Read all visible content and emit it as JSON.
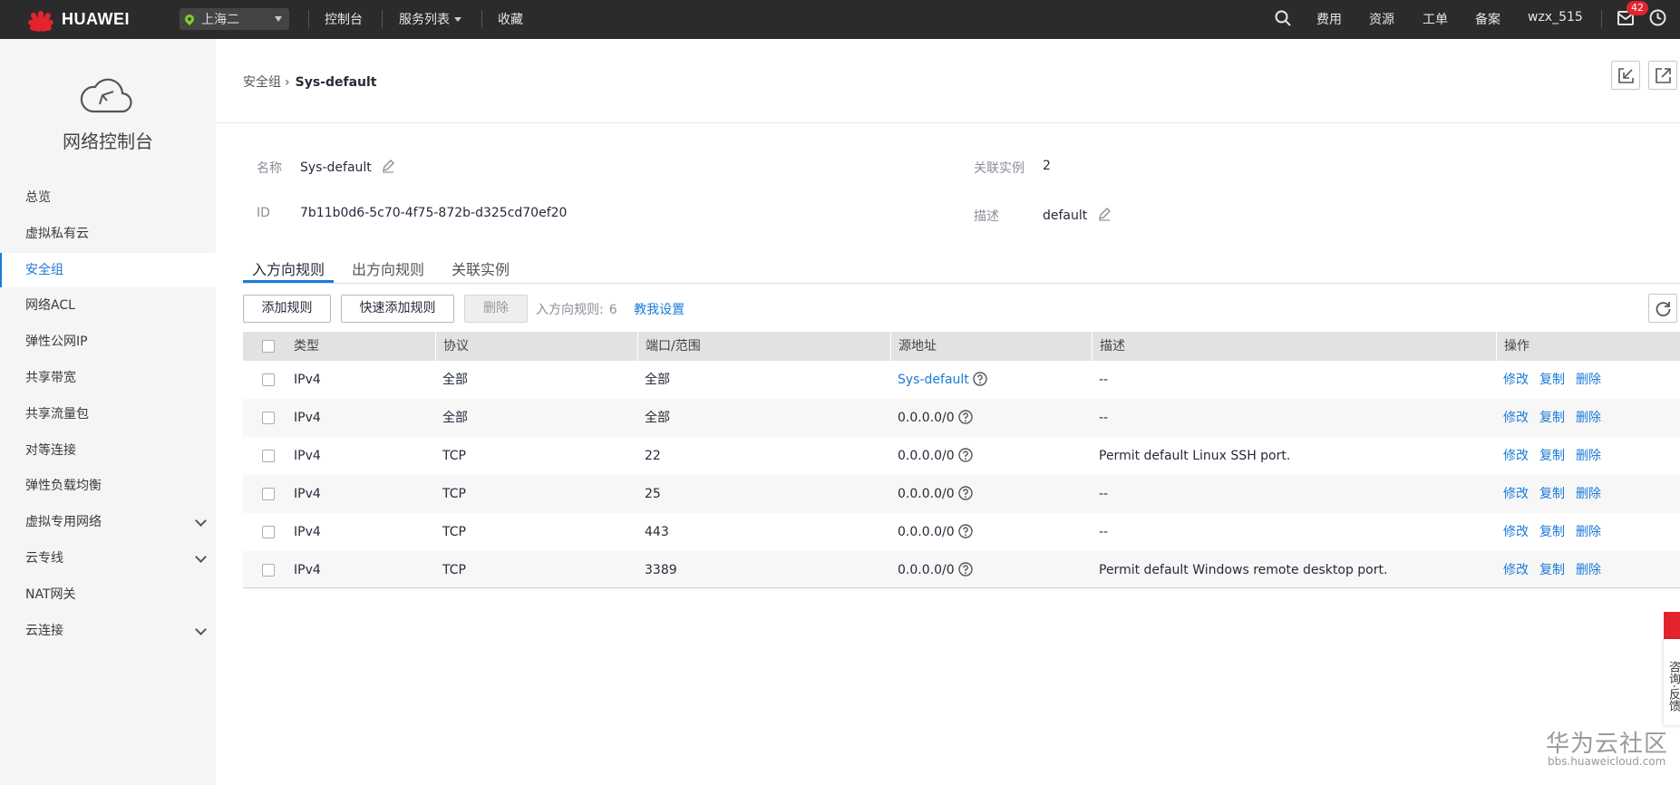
{
  "topbar": {
    "brand": "HUAWEI",
    "region": "上海二",
    "nav": [
      "控制台",
      "服务列表",
      "收藏"
    ],
    "right_links": [
      "费用",
      "资源",
      "工单",
      "备案"
    ],
    "username": "wzx_515",
    "mail_count": "42"
  },
  "sidebar": {
    "title": "网络控制台",
    "items": [
      {
        "label": "总览"
      },
      {
        "label": "虚拟私有云"
      },
      {
        "label": "安全组"
      },
      {
        "label": "网络ACL"
      },
      {
        "label": "弹性公网IP"
      },
      {
        "label": "共享带宽"
      },
      {
        "label": "共享流量包"
      },
      {
        "label": "对等连接"
      },
      {
        "label": "弹性负载均衡"
      },
      {
        "label": "虚拟专用网络"
      },
      {
        "label": "云专线"
      },
      {
        "label": "NAT网关"
      },
      {
        "label": "云连接"
      }
    ],
    "active": "安全组"
  },
  "breadcrumb": {
    "parent": "安全组",
    "sep": "›",
    "current": "Sys-default"
  },
  "info": {
    "name_label": "名称",
    "name_value": "Sys-default",
    "id_label": "ID",
    "id_value": "7b11b0d6-5c70-4f75-872b-d325cd70ef20",
    "instances_label": "关联实例",
    "instances_value": "2",
    "desc_label": "描述",
    "desc_value": "default"
  },
  "tabs": [
    "入方向规则",
    "出方向规则",
    "关联实例"
  ],
  "toolbar": {
    "add_rule": "添加规则",
    "quick_add": "快速添加规则",
    "delete": "删除",
    "count_label": "入方向规则:",
    "count_value": "6",
    "help_link": "教我设置"
  },
  "table": {
    "headers": [
      "类型",
      "协议",
      "端口/范围",
      "源地址",
      "描述",
      "操作"
    ],
    "actions": [
      "修改",
      "复制",
      "删除"
    ],
    "rows": [
      {
        "type": "IPv4",
        "protocol": "全部",
        "port": "全部",
        "source": "Sys-default",
        "desc": "--"
      },
      {
        "type": "IPv4",
        "protocol": "全部",
        "port": "全部",
        "source": "0.0.0.0/0",
        "desc": "--"
      },
      {
        "type": "IPv4",
        "protocol": "TCP",
        "port": "22",
        "source": "0.0.0.0/0",
        "desc": "Permit default Linux SSH port."
      },
      {
        "type": "IPv4",
        "protocol": "TCP",
        "port": "25",
        "source": "0.0.0.0/0",
        "desc": "--"
      },
      {
        "type": "IPv4",
        "protocol": "TCP",
        "port": "443",
        "source": "0.0.0.0/0",
        "desc": "--"
      },
      {
        "type": "IPv4",
        "protocol": "TCP",
        "port": "3389",
        "source": "0.0.0.0/0",
        "desc": "Permit default Windows remote desktop port."
      }
    ]
  },
  "feedback": "咨询·反馈",
  "watermark": {
    "title": "华为云社区",
    "url": "bbs.huaweicloud.com"
  }
}
